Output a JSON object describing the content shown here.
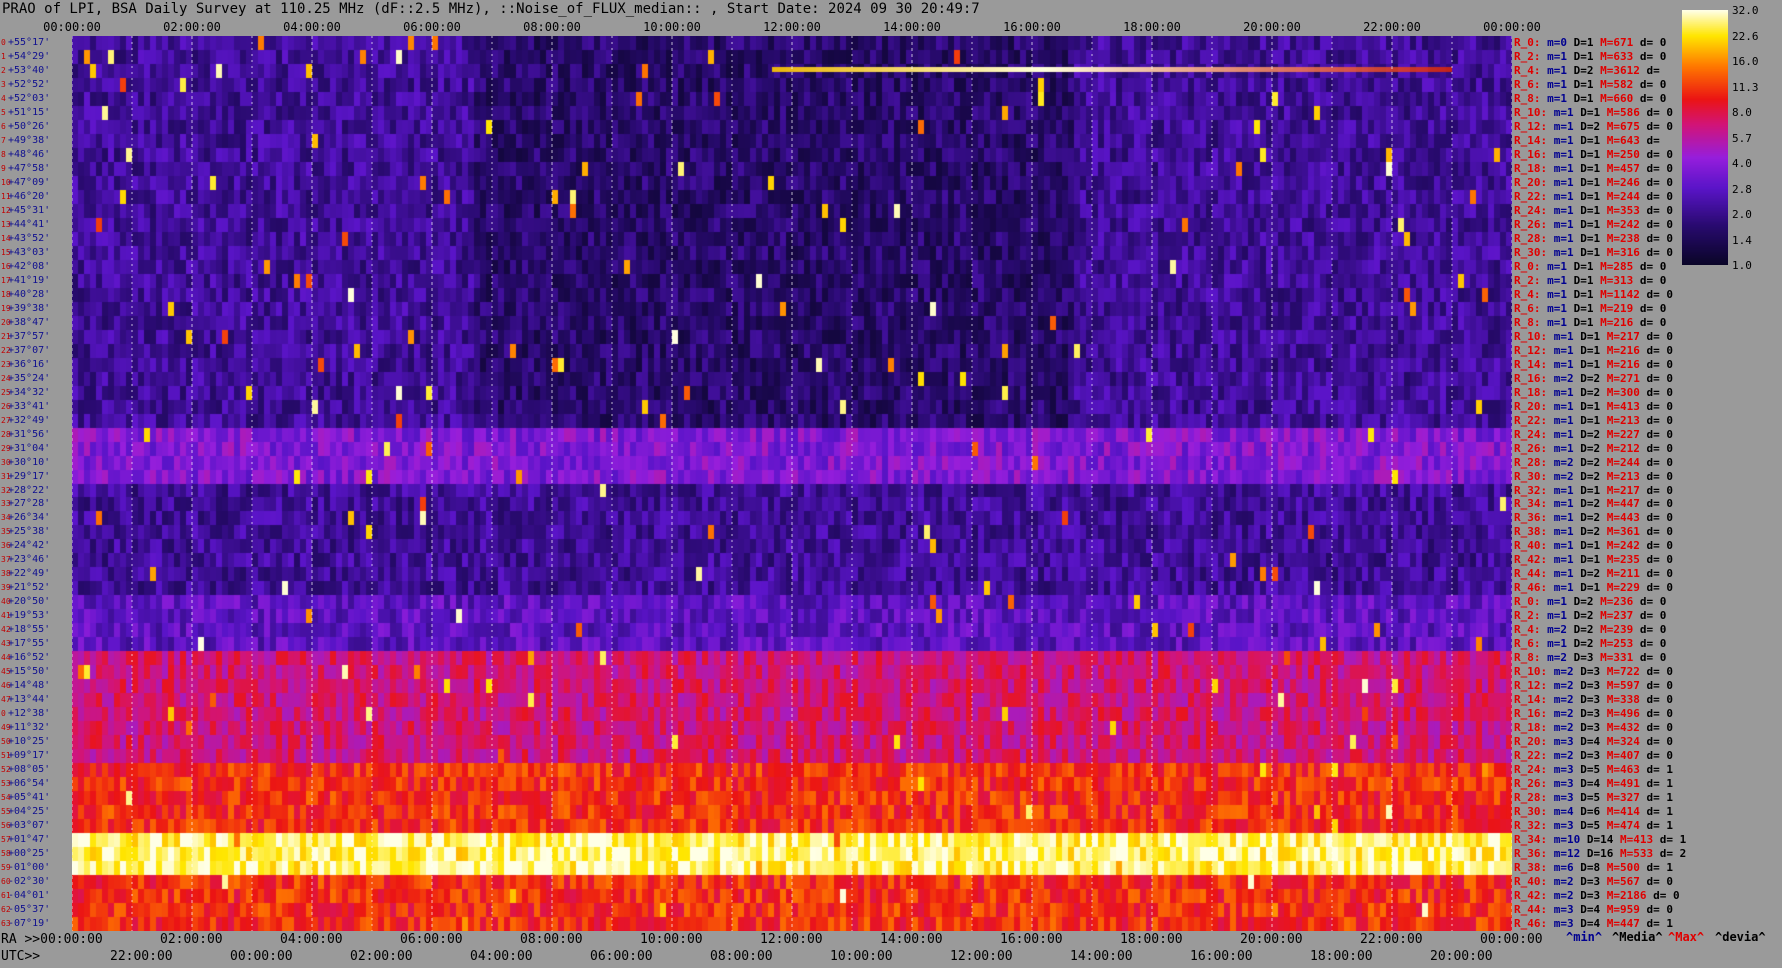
{
  "title": "PRAO of LPI, BSA Daily Survey at 110.25 MHz (dF::2.5 MHz), ::Noise_of_FLUX_median:: , Start Date: 2024 09 30 20:49:7",
  "chart_data": {
    "type": "heatmap",
    "title": "PRAO of LPI, BSA Daily Survey at 110.25 MHz (dF::2.5 MHz), ::Noise_of_FLUX_median:: , Start Date: 2024 09 30 20:49:7",
    "x_ticks_ra": [
      "00:00:00",
      "02:00:00",
      "04:00:00",
      "06:00:00",
      "08:00:00",
      "10:00:00",
      "12:00:00",
      "14:00:00",
      "16:00:00",
      "18:00:00",
      "20:00:00",
      "22:00:00",
      "00:00:00"
    ],
    "x_ticks_utc": [
      "22:00:00",
      "00:00:00",
      "02:00:00",
      "04:00:00",
      "06:00:00",
      "08:00:00",
      "10:00:00",
      "12:00:00",
      "14:00:00",
      "16:00:00",
      "18:00:00",
      "20:00:00"
    ],
    "ra_label": "RA >>00:00:00",
    "utc_label": "UTC>>",
    "colorbar": {
      "ticks": [
        "32.0",
        "22.6",
        "16.0",
        "11.3",
        "8.0",
        "5.7",
        "4.0",
        "2.8",
        "2.0",
        "1.4",
        "1.0"
      ],
      "scale": "log"
    },
    "declinations": [
      "+55°17'",
      "+54°29'",
      "+53°40'",
      "+52°52'",
      "+52°03'",
      "+51°15'",
      "+50°26'",
      "+49°38'",
      "+48°46'",
      "+47°58'",
      "+47°09'",
      "+46°20'",
      "+45°31'",
      "+44°41'",
      "+43°52'",
      "+43°03'",
      "+42°08'",
      "+41°19'",
      "+40°28'",
      "+39°38'",
      "+38°47'",
      "+37°57'",
      "+37°07'",
      "+36°16'",
      "+35°24'",
      "+34°32'",
      "+33°41'",
      "+32°49'",
      "+31°56'",
      "+31°04'",
      "+30°10'",
      "+29°17'",
      "+28°22'",
      "+27°28'",
      "+26°34'",
      "+25°38'",
      "+24°42'",
      "+23°46'",
      "+22°49'",
      "+21°52'",
      "+20°50'",
      "+19°53'",
      "+18°55'",
      "+17°55'",
      "+16°52'",
      "+15°50'",
      "+14°48'",
      "+13°44'",
      "+12°38'",
      "+11°32'",
      "+10°25'",
      "+09°17'",
      "+08°05'",
      "+06°54'",
      "+05°41'",
      "+04°25'",
      "+03°07'",
      "+01°47'",
      "+00°25'",
      "-01°00'",
      "-02°30'",
      "-04°01'",
      "-05°37'",
      "-07°19'"
    ],
    "rows": [
      {
        "r": "R_0:",
        "m": "m=0",
        "D": "D=1",
        "M": "M=671",
        "d": "d= 0"
      },
      {
        "r": "R_2:",
        "m": "m=1",
        "D": "D=1",
        "M": "M=633",
        "d": "d= 0"
      },
      {
        "r": "R_4:",
        "m": "m=1",
        "D": "D=2",
        "M": "M=3612",
        "d": "d="
      },
      {
        "r": "R_6:",
        "m": "m=1",
        "D": "D=1",
        "M": "M=582",
        "d": "d= 0"
      },
      {
        "r": "R_8:",
        "m": "m=1",
        "D": "D=1",
        "M": "M=660",
        "d": "d= 0"
      },
      {
        "r": "R_10:",
        "m": "m=1",
        "D": "D=1",
        "M": "M=586",
        "d": "d= 0"
      },
      {
        "r": "R_12:",
        "m": "m=1",
        "D": "D=2",
        "M": "M=675",
        "d": "d= 0"
      },
      {
        "r": "R_14:",
        "m": "m=1",
        "D": "D=1",
        "M": "M=643",
        "d": "d="
      },
      {
        "r": "R_16:",
        "m": "m=1",
        "D": "D=1",
        "M": "M=250",
        "d": "d= 0"
      },
      {
        "r": "R_18:",
        "m": "m=1",
        "D": "D=1",
        "M": "M=457",
        "d": "d= 0"
      },
      {
        "r": "R_20:",
        "m": "m=1",
        "D": "D=1",
        "M": "M=246",
        "d": "d= 0"
      },
      {
        "r": "R_22:",
        "m": "m=1",
        "D": "D=1",
        "M": "M=244",
        "d": "d= 0"
      },
      {
        "r": "R_24:",
        "m": "m=1",
        "D": "D=1",
        "M": "M=353",
        "d": "d= 0"
      },
      {
        "r": "R_26:",
        "m": "m=1",
        "D": "D=1",
        "M": "M=242",
        "d": "d= 0"
      },
      {
        "r": "R_28:",
        "m": "m=1",
        "D": "D=1",
        "M": "M=238",
        "d": "d= 0"
      },
      {
        "r": "R_30:",
        "m": "m=1",
        "D": "D=1",
        "M": "M=316",
        "d": "d= 0"
      },
      {
        "r": "R_0:",
        "m": "m=1",
        "D": "D=1",
        "M": "M=285",
        "d": "d= 0"
      },
      {
        "r": "R_2:",
        "m": "m=1",
        "D": "D=1",
        "M": "M=313",
        "d": "d= 0"
      },
      {
        "r": "R_4:",
        "m": "m=1",
        "D": "D=1",
        "M": "M=1142",
        "d": "d= 0"
      },
      {
        "r": "R_6:",
        "m": "m=1",
        "D": "D=1",
        "M": "M=219",
        "d": "d= 0"
      },
      {
        "r": "R_8:",
        "m": "m=1",
        "D": "D=1",
        "M": "M=216",
        "d": "d= 0"
      },
      {
        "r": "R_10:",
        "m": "m=1",
        "D": "D=1",
        "M": "M=217",
        "d": "d= 0"
      },
      {
        "r": "R_12:",
        "m": "m=1",
        "D": "D=1",
        "M": "M=216",
        "d": "d= 0"
      },
      {
        "r": "R_14:",
        "m": "m=1",
        "D": "D=1",
        "M": "M=216",
        "d": "d= 0"
      },
      {
        "r": "R_16:",
        "m": "m=2",
        "D": "D=2",
        "M": "M=271",
        "d": "d= 0"
      },
      {
        "r": "R_18:",
        "m": "m=1",
        "D": "D=2",
        "M": "M=300",
        "d": "d= 0"
      },
      {
        "r": "R_20:",
        "m": "m=1",
        "D": "D=1",
        "M": "M=413",
        "d": "d= 0"
      },
      {
        "r": "R_22:",
        "m": "m=1",
        "D": "D=1",
        "M": "M=213",
        "d": "d= 0"
      },
      {
        "r": "R_24:",
        "m": "m=1",
        "D": "D=2",
        "M": "M=227",
        "d": "d= 0"
      },
      {
        "r": "R_26:",
        "m": "m=1",
        "D": "D=2",
        "M": "M=212",
        "d": "d= 0"
      },
      {
        "r": "R_28:",
        "m": "m=2",
        "D": "D=2",
        "M": "M=244",
        "d": "d= 0"
      },
      {
        "r": "R_30:",
        "m": "m=2",
        "D": "D=2",
        "M": "M=213",
        "d": "d= 0"
      },
      {
        "r": "R_32:",
        "m": "m=1",
        "D": "D=1",
        "M": "M=217",
        "d": "d= 0"
      },
      {
        "r": "R_34:",
        "m": "m=1",
        "D": "D=2",
        "M": "M=447",
        "d": "d= 0"
      },
      {
        "r": "R_36:",
        "m": "m=1",
        "D": "D=2",
        "M": "M=443",
        "d": "d= 0"
      },
      {
        "r": "R_38:",
        "m": "m=1",
        "D": "D=2",
        "M": "M=361",
        "d": "d= 0"
      },
      {
        "r": "R_40:",
        "m": "m=1",
        "D": "D=1",
        "M": "M=242",
        "d": "d= 0"
      },
      {
        "r": "R_42:",
        "m": "m=1",
        "D": "D=1",
        "M": "M=235",
        "d": "d= 0"
      },
      {
        "r": "R_44:",
        "m": "m=1",
        "D": "D=2",
        "M": "M=211",
        "d": "d= 0"
      },
      {
        "r": "R_46:",
        "m": "m=1",
        "D": "D=1",
        "M": "M=229",
        "d": "d= 0"
      },
      {
        "r": "R_0:",
        "m": "m=1",
        "D": "D=2",
        "M": "M=236",
        "d": "d= 0"
      },
      {
        "r": "R_2:",
        "m": "m=1",
        "D": "D=2",
        "M": "M=237",
        "d": "d= 0"
      },
      {
        "r": "R_4:",
        "m": "m=2",
        "D": "D=2",
        "M": "M=239",
        "d": "d= 0"
      },
      {
        "r": "R_6:",
        "m": "m=1",
        "D": "D=2",
        "M": "M=253",
        "d": "d= 0"
      },
      {
        "r": "R_8:",
        "m": "m=2",
        "D": "D=3",
        "M": "M=331",
        "d": "d= 0"
      },
      {
        "r": "R_10:",
        "m": "m=2",
        "D": "D=3",
        "M": "M=722",
        "d": "d= 0"
      },
      {
        "r": "R_12:",
        "m": "m=2",
        "D": "D=3",
        "M": "M=597",
        "d": "d= 0"
      },
      {
        "r": "R_14:",
        "m": "m=2",
        "D": "D=3",
        "M": "M=338",
        "d": "d= 0"
      },
      {
        "r": "R_16:",
        "m": "m=2",
        "D": "D=3",
        "M": "M=496",
        "d": "d= 0"
      },
      {
        "r": "R_18:",
        "m": "m=2",
        "D": "D=3",
        "M": "M=432",
        "d": "d= 0"
      },
      {
        "r": "R_20:",
        "m": "m=3",
        "D": "D=4",
        "M": "M=324",
        "d": "d= 0"
      },
      {
        "r": "R_22:",
        "m": "m=2",
        "D": "D=3",
        "M": "M=407",
        "d": "d= 0"
      },
      {
        "r": "R_24:",
        "m": "m=3",
        "D": "D=5",
        "M": "M=463",
        "d": "d= 1"
      },
      {
        "r": "R_26:",
        "m": "m=3",
        "D": "D=4",
        "M": "M=491",
        "d": "d= 1"
      },
      {
        "r": "R_28:",
        "m": "m=3",
        "D": "D=5",
        "M": "M=327",
        "d": "d= 1"
      },
      {
        "r": "R_30:",
        "m": "m=4",
        "D": "D=6",
        "M": "M=414",
        "d": "d= 1"
      },
      {
        "r": "R_32:",
        "m": "m=3",
        "D": "D=5",
        "M": "M=474",
        "d": "d= 1"
      },
      {
        "r": "R_34:",
        "m": "m=10",
        "D": "D=14",
        "M": "M=413",
        "d": "d= 1"
      },
      {
        "r": "R_36:",
        "m": "m=12",
        "D": "D=16",
        "M": "M=533",
        "d": "d= 2"
      },
      {
        "r": "R_38:",
        "m": "m=6",
        "D": "D=8",
        "M": "M=500",
        "d": "d= 1"
      },
      {
        "r": "R_40:",
        "m": "m=2",
        "D": "D=3",
        "M": "M=567",
        "d": "d= 0"
      },
      {
        "r": "R_42:",
        "m": "m=2",
        "D": "D=3",
        "M": "M=2186",
        "d": "d= 0"
      },
      {
        "r": "R_44:",
        "m": "m=3",
        "D": "D=4",
        "M": "M=959",
        "d": "d= 0"
      },
      {
        "r": "R_46:",
        "m": "m=3",
        "D": "D=4",
        "M": "M=447",
        "d": "d= 1"
      }
    ],
    "legend": [
      "^min^",
      "^Media^",
      "^Max^",
      "^devia^"
    ],
    "colors": {
      "min": "#000090",
      "media": "#000000",
      "max": "#e00000",
      "devia": "#000000"
    }
  }
}
